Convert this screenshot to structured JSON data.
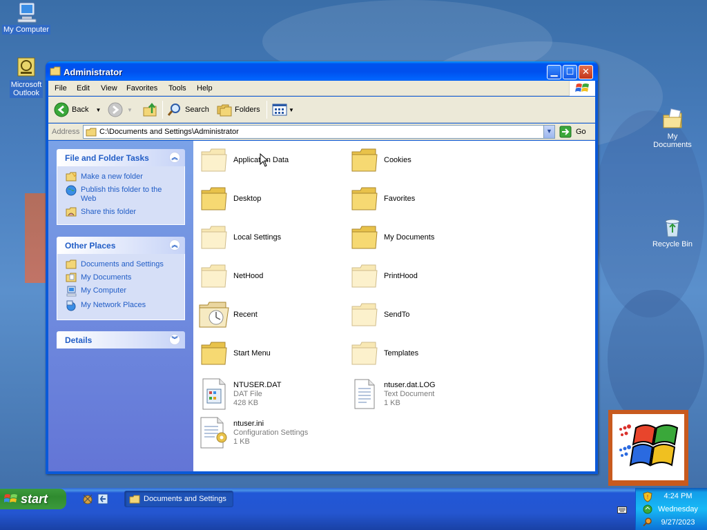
{
  "desktop": {
    "icons": {
      "my_computer": "My Computer",
      "outlook_line1": "Microsoft",
      "outlook_line2": "Outlook",
      "my_documents": "My Documents",
      "recycle_bin": "Recycle Bin"
    }
  },
  "window": {
    "title": "Administrator",
    "menu": [
      "File",
      "Edit",
      "View",
      "Favorites",
      "Tools",
      "Help"
    ],
    "toolbar": {
      "back": "Back",
      "search": "Search",
      "folders": "Folders"
    },
    "address": {
      "label": "Address",
      "value": "C:\\Documents and Settings\\Administrator",
      "go": "Go"
    },
    "left_pane": {
      "file_tasks": {
        "title": "File and Folder Tasks",
        "items": [
          "Make a new folder",
          "Publish this folder to the Web",
          "Share this folder"
        ]
      },
      "other_places": {
        "title": "Other Places",
        "items": [
          "Documents and Settings",
          "My Documents",
          "My Computer",
          "My Network Places"
        ]
      },
      "details": {
        "title": "Details"
      }
    },
    "items": [
      {
        "name": "Application Data",
        "type": "folder-faded"
      },
      {
        "name": "Cookies",
        "type": "folder"
      },
      {
        "name": "Desktop",
        "type": "folder"
      },
      {
        "name": "Favorites",
        "type": "folder"
      },
      {
        "name": "Local Settings",
        "type": "folder-faded"
      },
      {
        "name": "My Documents",
        "type": "folder"
      },
      {
        "name": "NetHood",
        "type": "folder-faded"
      },
      {
        "name": "PrintHood",
        "type": "folder-faded"
      },
      {
        "name": "Recent",
        "type": "folder-recent"
      },
      {
        "name": "SendTo",
        "type": "folder-faded"
      },
      {
        "name": "Start Menu",
        "type": "folder"
      },
      {
        "name": "Templates",
        "type": "folder-faded"
      },
      {
        "name": "NTUSER.DAT",
        "line2": "DAT File",
        "line3": "428 KB",
        "type": "dat-file"
      },
      {
        "name": "ntuser.dat.LOG",
        "line2": "Text Document",
        "line3": "1 KB",
        "type": "text-file"
      },
      {
        "name": "ntuser.ini",
        "line2": "Configuration Settings",
        "line3": "1 KB",
        "type": "ini-file"
      }
    ]
  },
  "taskbar": {
    "start": "start",
    "task_button": "Documents and Settings",
    "clock": {
      "time": "4:24 PM",
      "day": "Wednesday",
      "date": "9/27/2023"
    }
  },
  "colors": {
    "title_blue": "#0053ee",
    "task_link": "#215dc6",
    "start_green": "#3c9a3c"
  }
}
